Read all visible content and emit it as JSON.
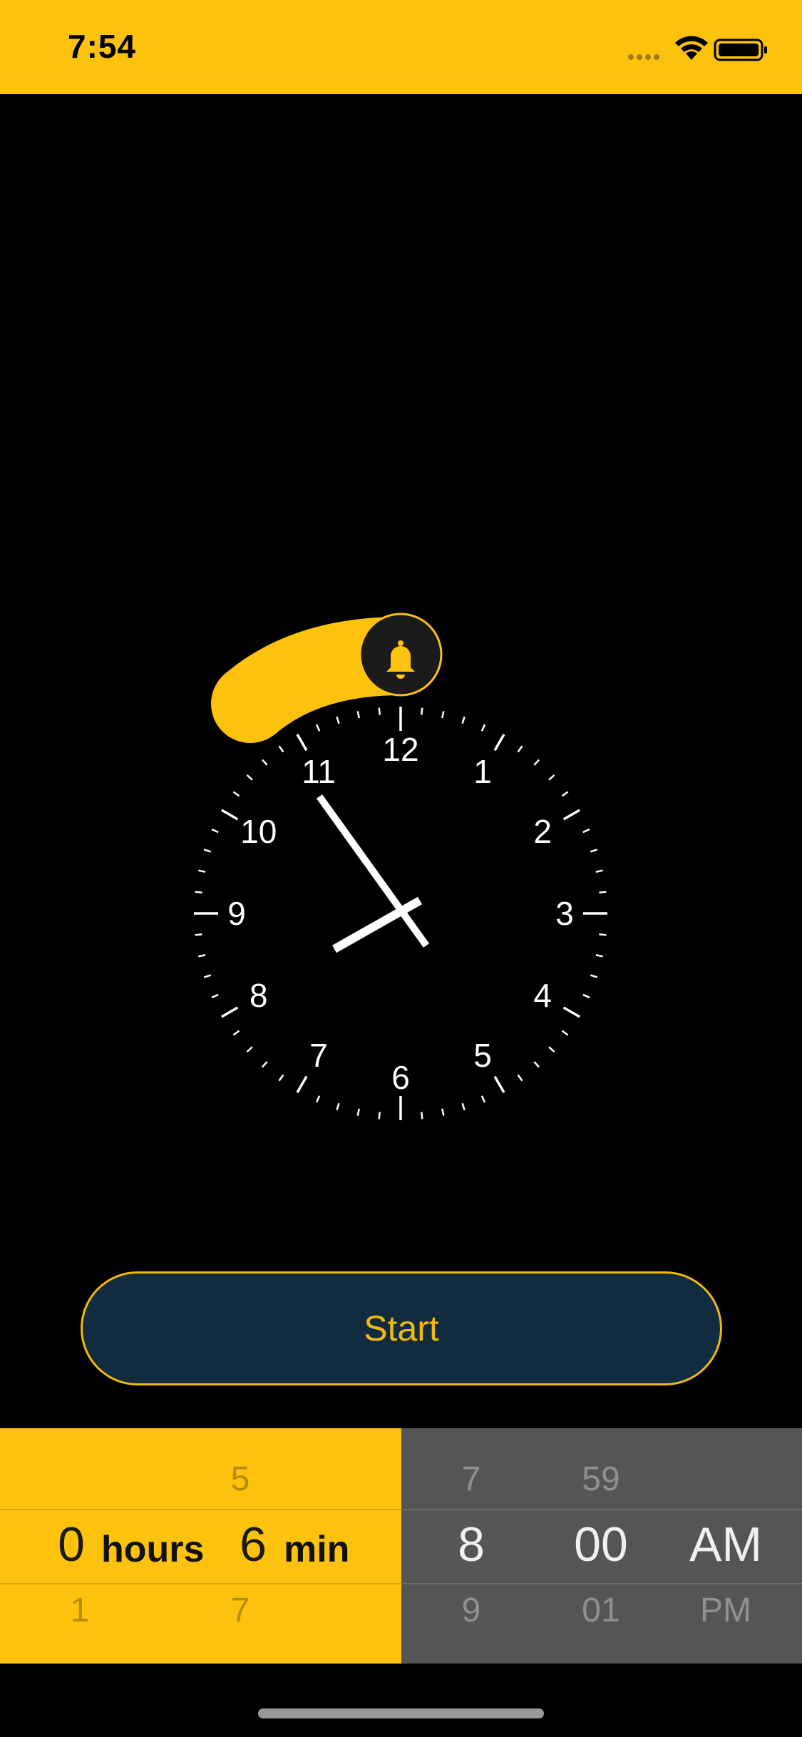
{
  "status_bar": {
    "time": "7:54",
    "signal_icon": "signal-dots-icon",
    "wifi_icon": "wifi-icon",
    "battery_icon": "battery-icon"
  },
  "clock": {
    "numerals": [
      "12",
      "1",
      "2",
      "3",
      "4",
      "5",
      "6",
      "7",
      "8",
      "9",
      "10",
      "11"
    ],
    "hour_hand_icon": "hour-hand",
    "minute_hand_icon": "minute-hand",
    "alarm_icon": "bell-icon",
    "accent_color": "#FDC20E"
  },
  "start_button": {
    "label": "Start",
    "border_color": "#F2B90F",
    "bg_color": "#112C3F"
  },
  "duration_picker": {
    "hours": {
      "prev": "",
      "selected": "0",
      "next": "1"
    },
    "hours_unit": "hours",
    "minutes": {
      "prev": "5",
      "selected": "6",
      "next": "7"
    },
    "minutes_unit": "min"
  },
  "time_picker": {
    "hour": {
      "prev": "7",
      "selected": "8",
      "next": "9"
    },
    "minute": {
      "prev": "59",
      "selected": "00",
      "next": "01"
    },
    "meridiem": {
      "prev": "",
      "selected": "AM",
      "next": "PM"
    }
  }
}
